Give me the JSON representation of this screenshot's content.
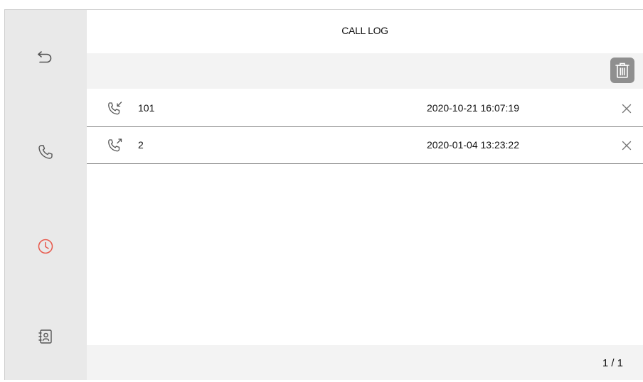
{
  "app": {
    "title": "CALL LOG"
  },
  "sidebar": {
    "items": [
      {
        "name": "back",
        "icon": "back-arrow-icon",
        "active": false
      },
      {
        "name": "call",
        "icon": "phone-icon",
        "active": false
      },
      {
        "name": "call-log",
        "icon": "clock-icon",
        "active": true
      },
      {
        "name": "contacts",
        "icon": "contacts-book-icon",
        "active": false
      }
    ],
    "active_color": "#e8584b",
    "inactive_color": "#555555"
  },
  "toolbar": {
    "delete_all_icon": "trash-icon"
  },
  "calls": [
    {
      "direction": "incoming",
      "icon": "incoming-call-icon",
      "number": "101",
      "time": "2020-10-21 16:07:19"
    },
    {
      "direction": "outgoing",
      "icon": "outgoing-call-icon",
      "number": "2",
      "time": "2020-01-04 13:23:22"
    }
  ],
  "pagination": {
    "label": "1 / 1"
  }
}
